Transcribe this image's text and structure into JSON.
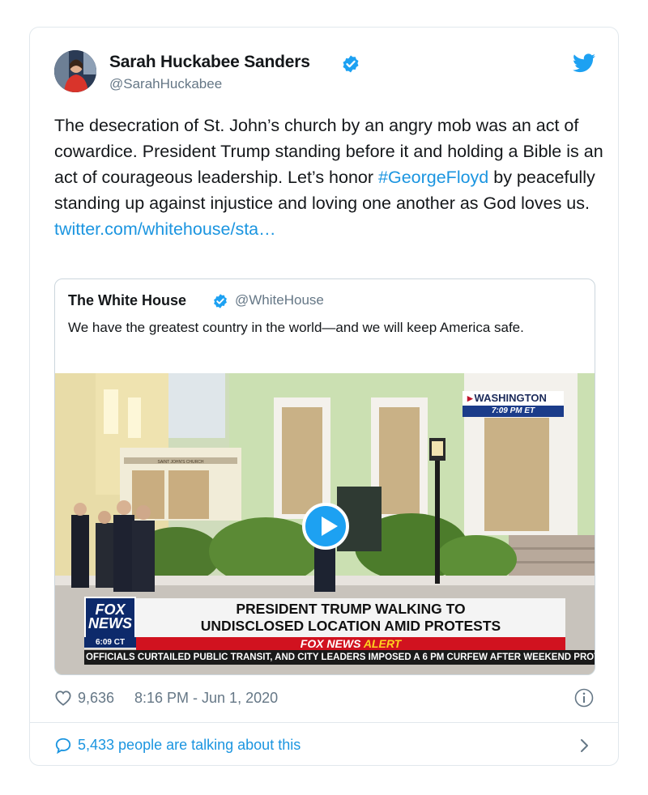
{
  "tweet": {
    "author_name": "Sarah Huckabee Sanders",
    "author_handle": "@SarahHuckabee",
    "text_part1": "The desecration of St. John’s church by an angry mob was an act of cowardice. President Trump standing before it and holding a Bible is an act of courageous leadership. Let’s honor ",
    "hashtag": "#GeorgeFloyd",
    "text_part2": " by peacefully standing up against injustice and loving one another as God loves us.",
    "link": "twitter.com/whitehouse/sta…",
    "likes": "9,636",
    "timestamp": "8:16 PM - Jun 1, 2020",
    "talking": "5,433 people are talking about this"
  },
  "quoted": {
    "name": "The White House",
    "handle": "@WhiteHouse",
    "text": "We have the greatest country in the world—and we will keep America safe."
  },
  "video": {
    "location": "WASHINGTON",
    "local_time": "7:09 PM ET",
    "logo_line1": "FOX",
    "logo_line2": "NEWS",
    "logo_time": "6:09 CT",
    "headline_line1": "PRESIDENT TRUMP WALKING TO",
    "headline_line2": "UNDISCLOSED LOCATION AMID PROTESTS",
    "alert_part1": "FOX NEWS ",
    "alert_part2": "ALERT",
    "ticker": "OFFICIALS CURTAILED PUBLIC TRANSIT, AND CITY LEADERS IMPOSED A 6 PM CURFEW AFTER WEEKEND PROT",
    "church_sign": "SAINT JOHN'S CHURCH"
  },
  "colors": {
    "link": "#1b95e0",
    "verified": "#1da1f2",
    "muted": "#657786",
    "fox_red": "#d1121f",
    "fox_blue": "#0d2a6b"
  },
  "icons": [
    "verified-badge-icon",
    "twitter-bird-icon",
    "play-icon",
    "heart-icon",
    "info-icon",
    "speech-bubble-icon",
    "chevron-right-icon"
  ]
}
